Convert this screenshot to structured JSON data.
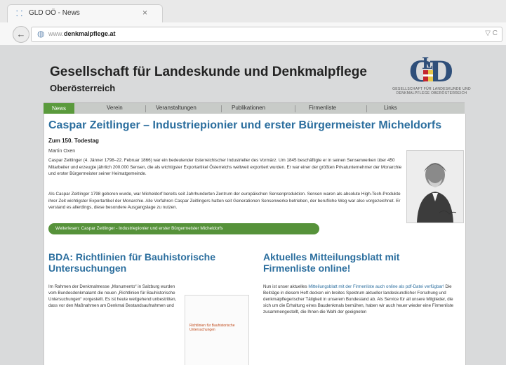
{
  "browser": {
    "tab_title": "GLD OÖ - News",
    "tab_close": "×",
    "url_prefix": "www.",
    "url": "denkmalpflege.at",
    "url_controls": "▽ C"
  },
  "site": {
    "title": "Gesellschaft für Landeskunde und Denkmalpflege",
    "subtitle": "Oberösterreich",
    "logo_caption": "GESELLSCHAFT FÜR LANDESKUNDE UND DENKMALPFLEGE OBERÖSTERREICH"
  },
  "nav": {
    "items": [
      "News",
      "Verein",
      "Veranstaltungen",
      "Publikationen",
      "Firmenliste",
      "Links"
    ]
  },
  "article": {
    "title": "Caspar Zeitlinger – Industriepionier und erster Bürgermeister Micheldorfs",
    "subtitle": "Zum 150. Todestag",
    "author": "Martin Oxen",
    "para1": "Caspar Zeitlinger (4. Jänner 1798–22. Februar 1866) war ein bedeutender österreichischer Industrieller des Vormärz. Um 1845 beschäftigte er in seinen Sensenwerken über 450 Mitarbeiter und erzeugte jährlich 200.000 Sensen, die als wichtigster Exportartikel Österreichs weltweit exportiert wurden. Er war einer der größten Privatunternehmer der Monarchie und erster Bürgermeister seiner Heimatgemeinde.",
    "para2": "Als Caspar Zeitlinger 1798 geboren wurde, war Micheldorf bereits seit Jahrhunderten Zentrum der europäischen Sensenproduktion. Sensen waren als absolute High-Tech-Produkte ihrer Zeit wichtigster Exportartikel der Monarchie. Alle Vorfahren Caspar Zeitlingers hatten seit Generationen Sensenwerke betrieben, der berufliche Weg war also vorgezeichnet. Er verstand es allerdings, diese besondere Ausgangslage zu nutzen.",
    "cta": "Weiterlesen: Caspar Zeitlinger - Industriepionier und erster Bürgermeister Micheldorfs"
  },
  "left_col": {
    "title": "BDA: Richtlinien für Bauhistorische Untersuchungen",
    "text": "Im Rahmen der Denkmalmesse „Monumento“ in Salzburg wurden vom Bundesdenkmalamt die neuen „Richtlinien für Bauhistorische Untersuchungen“ vorgestellt. Es ist heute weitgehend unbestritten, dass vor den Maßnahmen am Denkmal Bestandsaufnahmen und",
    "thumb_text": "Richtlinien für Bauhistorische Untersuchungen"
  },
  "right_col": {
    "title": "Aktuelles Mitteilungsblatt mit Firmenliste online!",
    "text_a": "Nun ist unser aktuelles ",
    "text_link": "Mitteilungsblatt mit der Firmenliste auch online als pdf-Datei verfügbar!",
    "text_b": " Die Beiträge in diesem Heft decken ein breites Spektrum aktueller landeskundlicher Forschung und denkmalpflegerischer Tätigkeit in unserem Bundesland ab. Als Service für all unsere Mitglieder, die sich um die Erhaltung eines Baudenkmals bemühen, haben wir auch heuer wieder eine Firmenliste zusammengestellt, die Ihnen die Wahl der geeigneten"
  },
  "colors": {
    "accent_blue": "#2b6e9e",
    "nav_green": "#5a9a3c",
    "logo_red": "#c4262e"
  }
}
